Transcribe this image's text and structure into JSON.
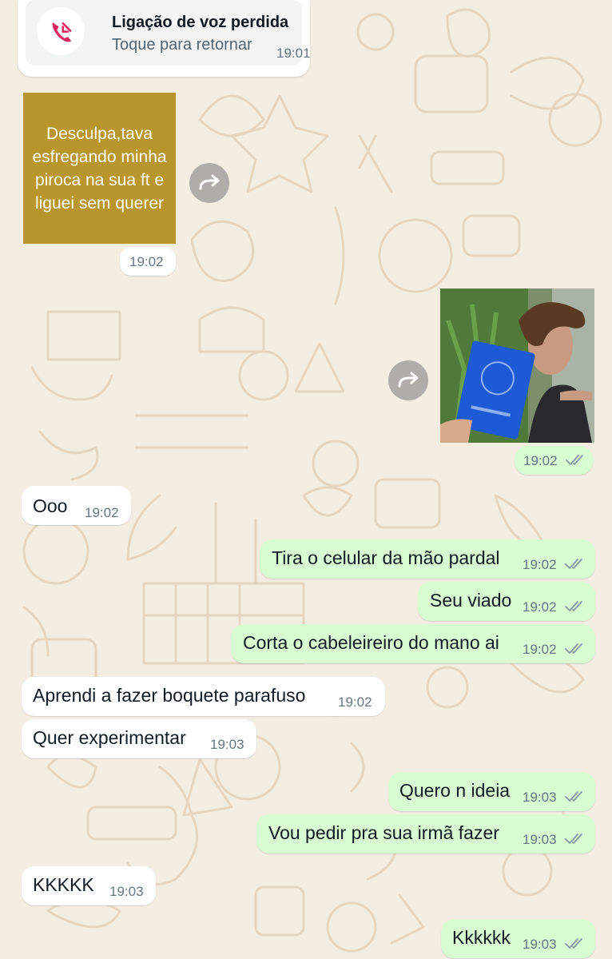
{
  "missed_call": {
    "title": "Ligação de voz perdida",
    "subtitle": "Toque para retornar",
    "time": "19:01",
    "icon": "missed-call-icon"
  },
  "image_message": {
    "text": "Desculpa,tava esfregando minha piroca na sua ft e liguei sem querer",
    "time": "19:02"
  },
  "photo_message": {
    "time": "19:02"
  },
  "messages": [
    {
      "dir": "in",
      "text": "Ooo",
      "time": "19:02"
    },
    {
      "dir": "out",
      "text": "Tira o celular da mão pardal",
      "time": "19:02"
    },
    {
      "dir": "out",
      "text": "Seu viado",
      "time": "19:02"
    },
    {
      "dir": "out",
      "text": "Corta o cabeleireiro do mano ai",
      "time": "19:02"
    },
    {
      "dir": "in",
      "text": "Aprendi a fazer boquete parafuso",
      "time": "19:02"
    },
    {
      "dir": "in",
      "text": "Quer experimentar",
      "time": "19:03"
    },
    {
      "dir": "out",
      "text": "Quero n ideia",
      "time": "19:03"
    },
    {
      "dir": "out",
      "text": "Vou pedir pra sua irmã fazer",
      "time": "19:03"
    },
    {
      "dir": "in",
      "text": "KKKKK",
      "time": "19:03"
    },
    {
      "dir": "out",
      "text": "Kkkkkk",
      "time": "19:03"
    }
  ],
  "colors": {
    "wallpaper": "#f4ede2",
    "incoming_bubble": "#ffffff",
    "outgoing_bubble": "#d9fdd3",
    "missed_call_red": "#e0245e",
    "gold_image": "#b8962c"
  }
}
